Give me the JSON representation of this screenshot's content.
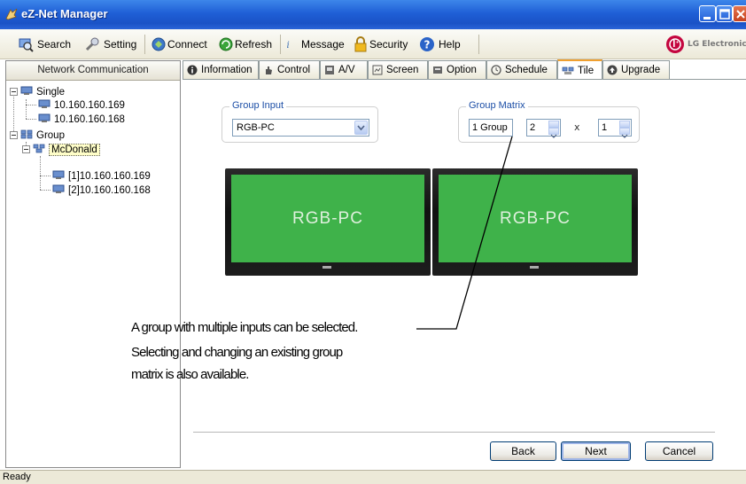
{
  "window": {
    "title": "eZ-Net Manager"
  },
  "toolbar": {
    "search": "Search",
    "setting": "Setting",
    "connect": "Connect",
    "refresh": "Refresh",
    "message": "Message",
    "security": "Security",
    "help": "Help",
    "brand": "LG Electronics"
  },
  "left_panel": {
    "header": "Network Communication",
    "tree": {
      "single": "Single",
      "single_ip_1": "10.160.160.169",
      "single_ip_2": "10.160.160.168",
      "group": "Group",
      "group_name": "McDonald",
      "group_ip_1": "[1]10.160.160.169",
      "group_ip_2": "[2]10.160.160.168"
    }
  },
  "tabs": [
    "Information",
    "Control",
    "A/V",
    "Screen",
    "Option",
    "Schedule",
    "Tile",
    "Upgrade"
  ],
  "active_tab": "Tile",
  "group_input": {
    "title": "Group Input",
    "value": "RGB-PC"
  },
  "group_matrix": {
    "title": "Group Matrix",
    "group": "1 Group",
    "rows": "2",
    "separator": "x",
    "cols": "1"
  },
  "monitors": [
    "RGB-PC",
    "RGB-PC"
  ],
  "annotations": {
    "line1": "A group with multiple inputs can be selected.",
    "line2": "Selecting and changing an existing group",
    "line3": "matrix is also available."
  },
  "buttons": {
    "back": "Back",
    "next": "Next",
    "cancel": "Cancel"
  },
  "status": "Ready",
  "colors": {
    "titlebar": "#1f5fd6",
    "group_title": "#1c4ea6",
    "screen": "#3fb24a",
    "lg_red": "#c4063f"
  }
}
